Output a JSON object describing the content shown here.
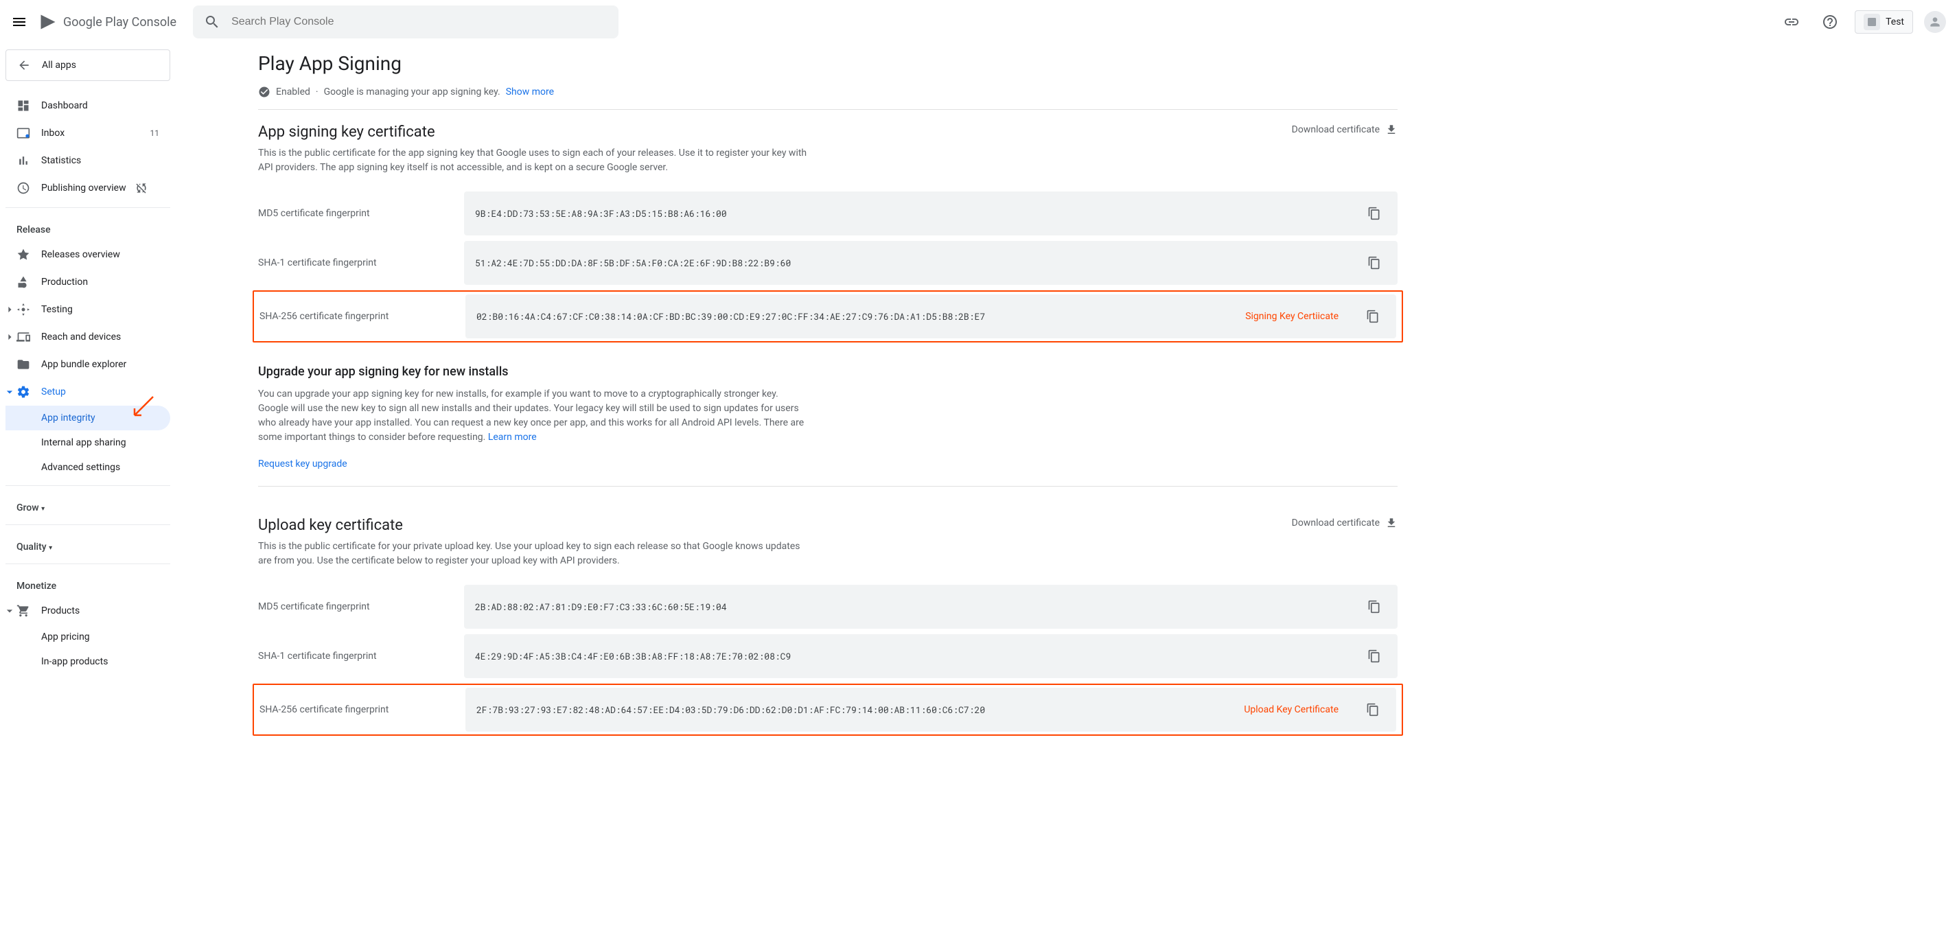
{
  "header": {
    "logo": "Google Play Console",
    "search_placeholder": "Search Play Console",
    "app_name": "Test"
  },
  "sidebar": {
    "all_apps": "All apps",
    "items": [
      {
        "label": "Dashboard"
      },
      {
        "label": "Inbox",
        "badge": "11"
      },
      {
        "label": "Statistics"
      },
      {
        "label": "Publishing overview"
      }
    ],
    "release_section": "Release",
    "release_items": [
      {
        "label": "Releases overview"
      },
      {
        "label": "Production"
      },
      {
        "label": "Testing"
      },
      {
        "label": "Reach and devices"
      },
      {
        "label": "App bundle explorer"
      },
      {
        "label": "Setup"
      },
      {
        "label": "App integrity"
      },
      {
        "label": "Internal app sharing"
      },
      {
        "label": "Advanced settings"
      }
    ],
    "grow_section": "Grow",
    "quality_section": "Quality",
    "monetize_section": "Monetize",
    "monetize_items": [
      {
        "label": "Products"
      },
      {
        "label": "App pricing"
      },
      {
        "label": "In-app products"
      }
    ]
  },
  "page": {
    "title": "Play App Signing",
    "status_enabled": "Enabled",
    "status_desc": "Google is managing your app signing key.",
    "show_more": "Show more"
  },
  "signing_cert": {
    "title": "App signing key certificate",
    "desc": "This is the public certificate for the app signing key that Google uses to sign each of your releases. Use it to register your key with API providers. The app signing key itself is not accessible, and is kept on a secure Google server.",
    "download": "Download certificate",
    "md5_label": "MD5 certificate fingerprint",
    "md5_value": "9B:E4:DD:73:53:5E:A8:9A:3F:A3:D5:15:B8:A6:16:00",
    "sha1_label": "SHA-1 certificate fingerprint",
    "sha1_value": "51:A2:4E:7D:55:DD:DA:8F:5B:DF:5A:F0:CA:2E:6F:9D:B8:22:B9:60",
    "sha256_label": "SHA-256 certificate fingerprint",
    "sha256_value": "02:B0:16:4A:C4:67:CF:C0:38:14:0A:CF:BD:BC:39:00:CD:E9:27:0C:FF:34:AE:27:C9:76:DA:A1:D5:B8:2B:E7",
    "annotation": "Signing Key Certiicate"
  },
  "upgrade": {
    "title": "Upgrade your app signing key for new installs",
    "desc": "You can upgrade your app signing key for new installs, for example if you want to move to a cryptographically stronger key. Google will use the new key to sign all new installs and their updates. Your legacy key will still be used to sign updates for users who already have your app installed. You can request a new key once per app, and this works for all Android API levels. There are some important things to consider before requesting.",
    "learn_more": "Learn more",
    "request": "Request key upgrade"
  },
  "upload_cert": {
    "title": "Upload key certificate",
    "desc": "This is the public certificate for your private upload key. Use your upload key to sign each release so that Google knows updates are from you. Use the certificate below to register your upload key with API providers.",
    "download": "Download certificate",
    "md5_label": "MD5 certificate fingerprint",
    "md5_value": "2B:AD:88:02:A7:81:D9:E0:F7:C3:33:6C:60:5E:19:04",
    "sha1_label": "SHA-1 certificate fingerprint",
    "sha1_value": "4E:29:9D:4F:A5:3B:C4:4F:E0:6B:3B:A8:FF:18:A8:7E:70:02:08:C9",
    "sha256_label": "SHA-256 certificate fingerprint",
    "sha256_value": "2F:7B:93:27:93:E7:82:48:AD:64:57:EE:D4:03:5D:79:D6:DD:62:D0:D1:AF:FC:79:14:00:AB:11:60:C6:C7:20",
    "annotation": "Upload Key Certificate"
  }
}
